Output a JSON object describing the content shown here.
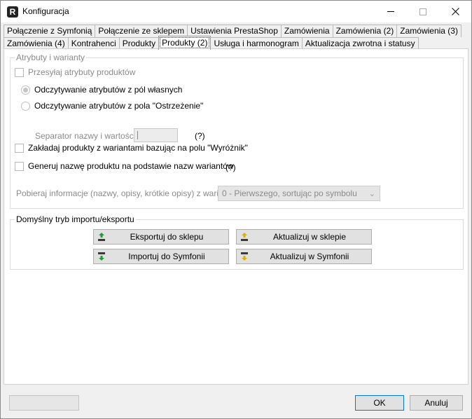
{
  "window": {
    "title": "Konfiguracja",
    "app_icon_letter": "R"
  },
  "tabs_row1": [
    "Połączenie z Symfonią",
    "Połączenie ze sklepem",
    "Ustawienia PrestaShop",
    "Zamówienia",
    "Zamówienia (2)",
    "Zamówienia (3)"
  ],
  "tabs_row2": [
    "Zamówienia (4)",
    "Kontrahenci",
    "Produkty",
    "Produkty (2)",
    "Usługa i harmonogram",
    "Aktualizacja zwrotna i statusy"
  ],
  "active_tab": "Produkty (2)",
  "attributes": {
    "legend": "Atrybuty i warianty",
    "send_attributes": "Przesyłaj atrybuty produktów",
    "radio_own_fields": "Odczytywanie atrybutów z pól własnych",
    "radio_warning_field": "Odczytywanie atrybutów z pola \"Ostrzeżenie\"",
    "separator_label": "Separator nazwy i wartości:",
    "separator_help": "(?)",
    "create_variants": "Zakładaj produkty z wariantami bazując na polu \"Wyróżnik\"",
    "generate_name": "Generuj nazwę produktu na podstawie nazw wariantów",
    "generate_name_help": "(?)",
    "info_label": "Pobieraj informacje (nazwy, opisy, krótkie opisy) z wariantu:",
    "info_value": "0 - Pierwszego, sortując po symbolu"
  },
  "import_export": {
    "legend": "Domyślny tryb importu/eksportu",
    "export_label": "Eksportuj do sklepu",
    "update_shop_label": "Aktualizuj w sklepie",
    "import_label": "Importuj do Symfonii",
    "update_symfonia_label": "Aktualizuj w Symfonii"
  },
  "footer": {
    "ok": "OK",
    "cancel": "Anuluj"
  },
  "colors": {
    "arrow_green": "#1e9c3a",
    "arrow_yellow": "#d8b400",
    "bar_dark": "#3a3a3a"
  }
}
